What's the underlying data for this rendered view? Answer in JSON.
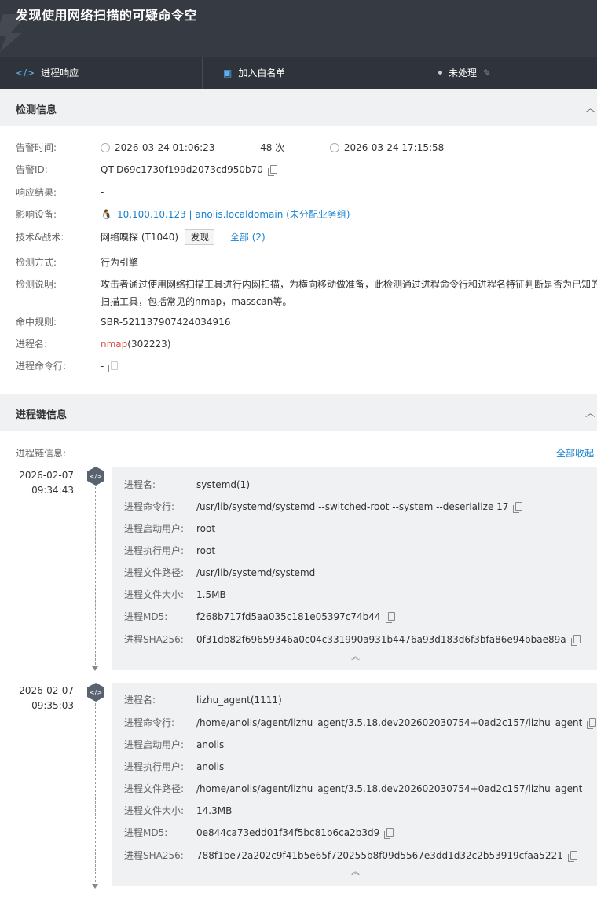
{
  "header": {
    "title": "发现使用网络扫描的可疑命令空"
  },
  "actions": [
    {
      "label": "进程响应",
      "icon": "code-icon"
    },
    {
      "label": "加入白名单",
      "icon": "whitelist-icon"
    },
    {
      "label": "未处理",
      "icon": "edit-icon"
    }
  ],
  "detection": {
    "title": "检测信息",
    "alert_time_label": "告警时间:",
    "first_time": "2026-03-24 01:06:23",
    "count": "48 次",
    "last_time": "2026-03-24 17:15:58",
    "alert_id_label": "告警ID:",
    "alert_id": "QT-D69c1730f199d2073cd950b70",
    "response_label": "响应结果:",
    "response": "-",
    "device_label": "影响设备:",
    "device": "10.100.10.123 | anolis.localdomain (未分配业务组)",
    "tactic_label": "技术&战术:",
    "tactic": "网络嗅探 (T1040)",
    "tactic_tag": "发现",
    "tactic_all": "全部 (2)",
    "method_label": "检测方式:",
    "method": "行为引擎",
    "desc_label": "检测说明:",
    "desc_line1": "攻击者通过使用网络扫描工具进行内网扫描，为横向移动做准备，此检测通过进程命令行和进程名特征判断是否为已知的",
    "desc_line2": "扫描工具，包括常见的nmap，masscan等。",
    "rule_label": "命中规则:",
    "rule": "SBR-521137907424034916",
    "proc_label": "进程名:",
    "proc_name": "nmap",
    "proc_pid": "(302223)",
    "cmd_label": "进程命令行:",
    "cmd": "-"
  },
  "chain": {
    "title": "进程链信息",
    "label": "进程链信息:",
    "collapse_all": "全部收起",
    "keys": {
      "name": "进程名:",
      "cmd": "进程命令行:",
      "start_user": "进程启动用户:",
      "exec_user": "进程执行用户:",
      "path": "进程文件路径:",
      "size": "进程文件大小:",
      "md5": "进程MD5:",
      "sha": "进程SHA256:"
    },
    "items": [
      {
        "date": "2026-02-07",
        "time": "09:34:43",
        "name": "systemd(1)",
        "cmd": "/usr/lib/systemd/systemd --switched-root --system --deserialize 17",
        "start_user": "root",
        "exec_user": "root",
        "path": "/usr/lib/systemd/systemd",
        "size": "1.5MB",
        "md5": "f268b717fd5aa035c181e05397c74b44",
        "sha": "0f31db82f69659346a0c04c331990a931b4476a93d183d6f3bfa86e94bbae89a"
      },
      {
        "date": "2026-02-07",
        "time": "09:35:03",
        "name": "lizhu_agent(1111)",
        "cmd": "/home/anolis/agent/lizhu_agent/3.5.18.dev202602030754+0ad2c157/lizhu_agent",
        "start_user": "anolis",
        "exec_user": "anolis",
        "path": "/home/anolis/agent/lizhu_agent/3.5.18.dev202602030754+0ad2c157/lizhu_agent",
        "size": "14.3MB",
        "md5": "0e844ca73edd01f34f5bc81b6ca2b3d9",
        "sha": "788f1be72a202c9f41b5e65f720255b8f09d5567e3dd1d32c2b53919cfaa5221"
      }
    ]
  }
}
